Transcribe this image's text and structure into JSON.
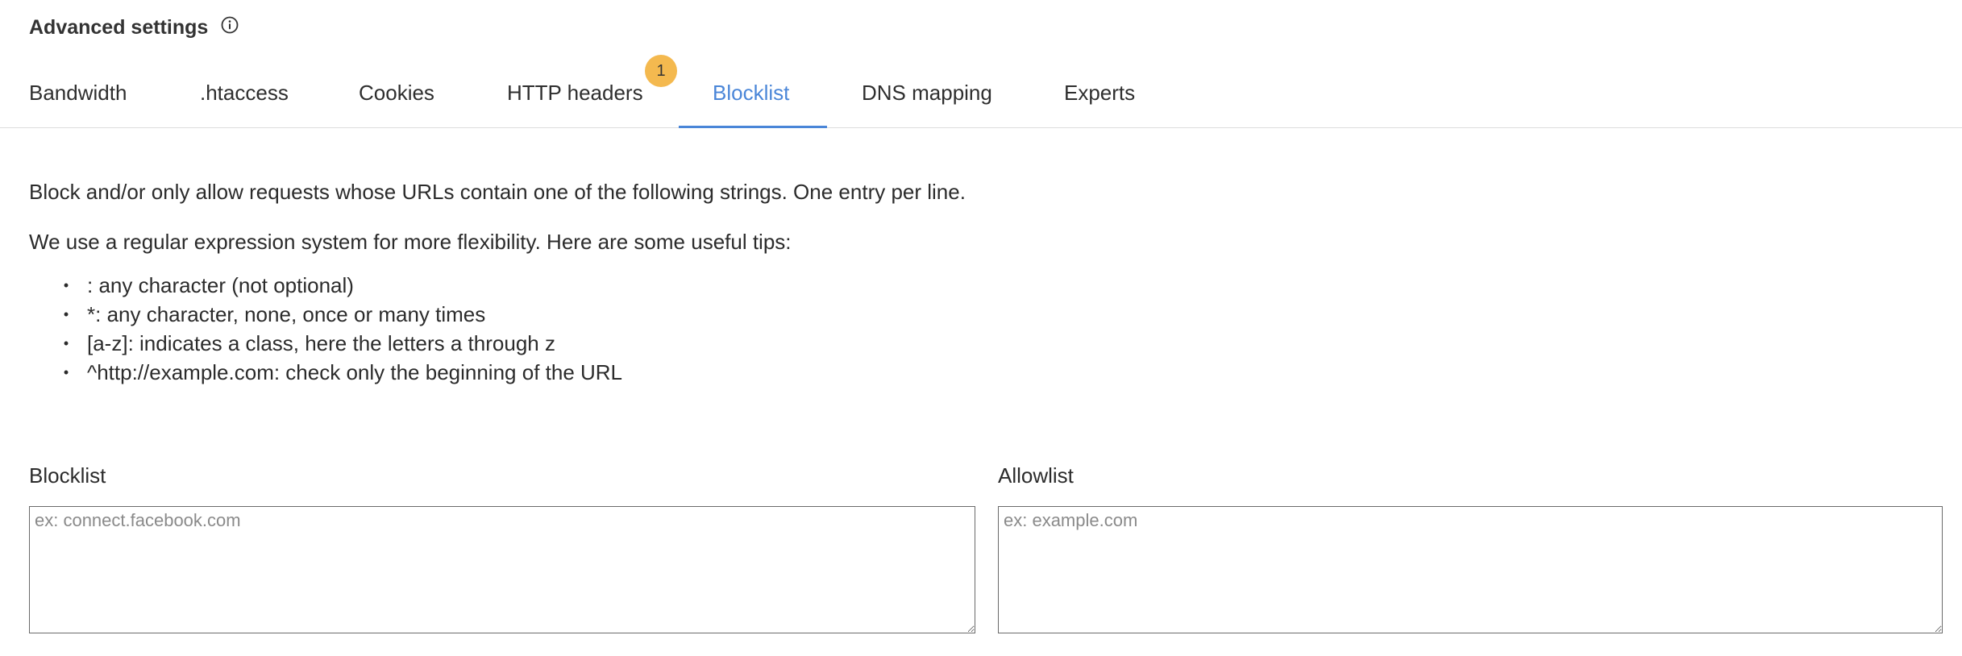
{
  "header": {
    "title": "Advanced settings",
    "info_icon": "info-icon"
  },
  "tabs": [
    {
      "label": "Bandwidth",
      "active": false
    },
    {
      "label": ".htaccess",
      "active": false
    },
    {
      "label": "Cookies",
      "active": false
    },
    {
      "label": "HTTP headers",
      "active": false,
      "badge": "1"
    },
    {
      "label": "Blocklist",
      "active": true
    },
    {
      "label": "DNS mapping",
      "active": false
    },
    {
      "label": "Experts",
      "active": false
    }
  ],
  "colors": {
    "accent": "#4a86d8",
    "badge": "#f4b94f",
    "text": "#2b2b2b",
    "divider": "#dcdcdc"
  },
  "content": {
    "intro": "Block and/or only allow requests whose URLs contain one of the following strings. One entry per line.",
    "regex_note": "We use a regular expression system for more flexibility. Here are some useful tips:",
    "tips": [
      ": any character (not optional)",
      "*: any character, none, once or many times",
      "[a-z]: indicates a class, here the letters a through z",
      "^http://example.com: check only the beginning of the URL"
    ]
  },
  "blocklist": {
    "label": "Blocklist",
    "value": "",
    "placeholder": "ex: connect.facebook.com"
  },
  "allowlist": {
    "label": "Allowlist",
    "value": "",
    "placeholder": "ex: example.com"
  }
}
